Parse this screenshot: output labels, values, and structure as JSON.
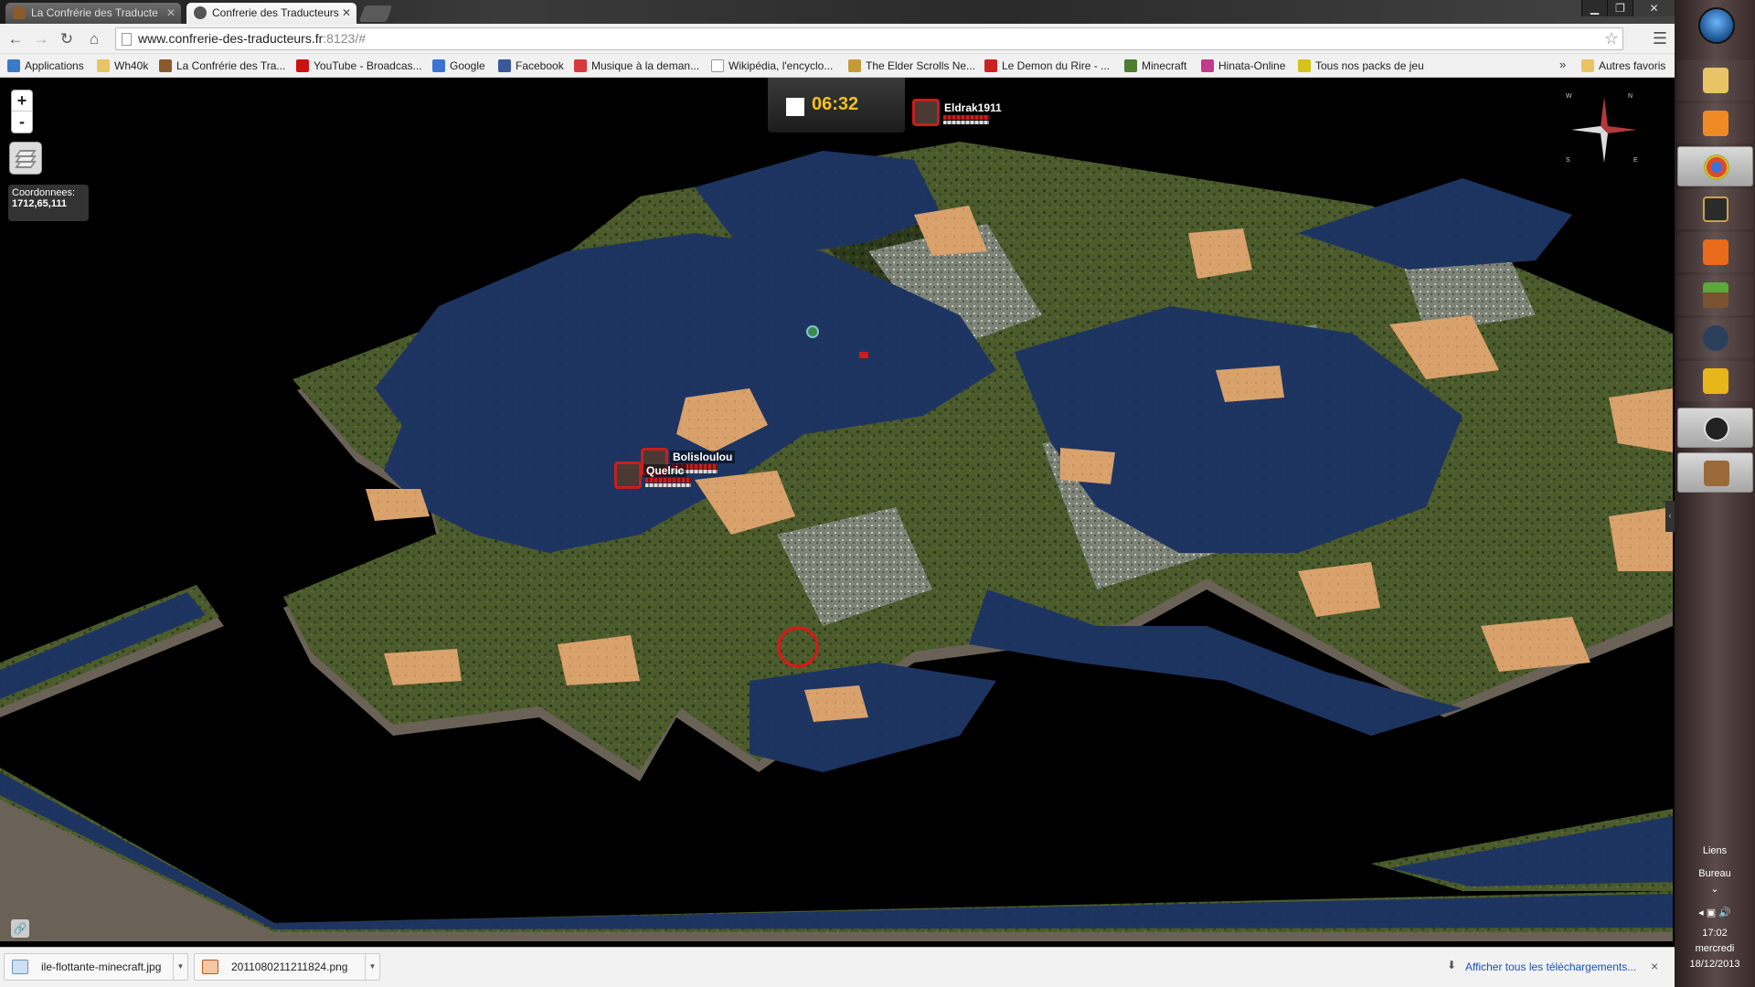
{
  "browser": {
    "tabs": [
      {
        "label": "La Confrérie des Traducte",
        "active": false
      },
      {
        "label": "Confrerie des Traducteurs",
        "active": true
      }
    ],
    "url_main": "www.confrerie-des-traducteurs.fr",
    "url_rest": ":8123/#",
    "bookmarks": [
      {
        "label": "Applications",
        "icon": "apps-grid-icon",
        "color": "#3a7ac8"
      },
      {
        "label": "Wh40k",
        "icon": "folder-icon",
        "color": "#e8c465"
      },
      {
        "label": "La Confrérie des Tra...",
        "icon": "confrerie-icon",
        "color": "#8a5a2b"
      },
      {
        "label": "YouTube - Broadcas...",
        "icon": "youtube-icon",
        "color": "#cc1111"
      },
      {
        "label": "Google",
        "icon": "google-icon",
        "color": "#3b73d8"
      },
      {
        "label": "Facebook",
        "icon": "facebook-icon",
        "color": "#3b5998"
      },
      {
        "label": "Musique à la deman...",
        "icon": "music-icon",
        "color": "#d43a3a"
      },
      {
        "label": "Wikipédia, l'encyclo...",
        "icon": "wikipedia-icon",
        "color": "#ffffff"
      },
      {
        "label": "The Elder Scrolls Ne...",
        "icon": "elderscrolls-icon",
        "color": "#c59b3a"
      },
      {
        "label": "Le Demon du Rire - ...",
        "icon": "free-icon",
        "color": "#cc2222"
      },
      {
        "label": "Minecraft",
        "icon": "minecraft-icon",
        "color": "#4d7d2f"
      },
      {
        "label": "Hinata-Online",
        "icon": "hinata-icon",
        "color": "#c23a8a"
      },
      {
        "label": "Tous nos packs de jeu",
        "icon": "pack-icon",
        "color": "#d6c21a"
      }
    ],
    "bookmarks_overflow": "»",
    "other_bookmarks": "Autres favoris"
  },
  "map": {
    "coord_label": "Coordonnees:",
    "coord_value": "1712,65,111",
    "time": "06:32",
    "zoom_in": "+",
    "zoom_out": "-",
    "compass": {
      "n": "N",
      "e": "E",
      "s": "S",
      "w": "W"
    },
    "players": [
      {
        "name": "Eldrak1911"
      },
      {
        "name": "Bolisloulou"
      },
      {
        "name": "Quelric"
      }
    ]
  },
  "downloads": {
    "items": [
      {
        "name": "ile-flottante-minecraft.jpg"
      },
      {
        "name": "2011080211211824.png"
      }
    ],
    "show_all": "Afficher tous les téléchargements...",
    "close": "×"
  },
  "taskbar": {
    "links_label": "Liens",
    "desktop_label": "Bureau",
    "clock_time": "17:02",
    "clock_day": "mercredi",
    "clock_date": "18/12/2013"
  },
  "colors": {
    "water": "#1d3461",
    "grass": "#4b5b2c",
    "forest": "#2e3a1c",
    "sand": "#d9a16b",
    "rock": "#8e9385",
    "cliff": "#6b6257",
    "marker_red": "#e01515"
  }
}
